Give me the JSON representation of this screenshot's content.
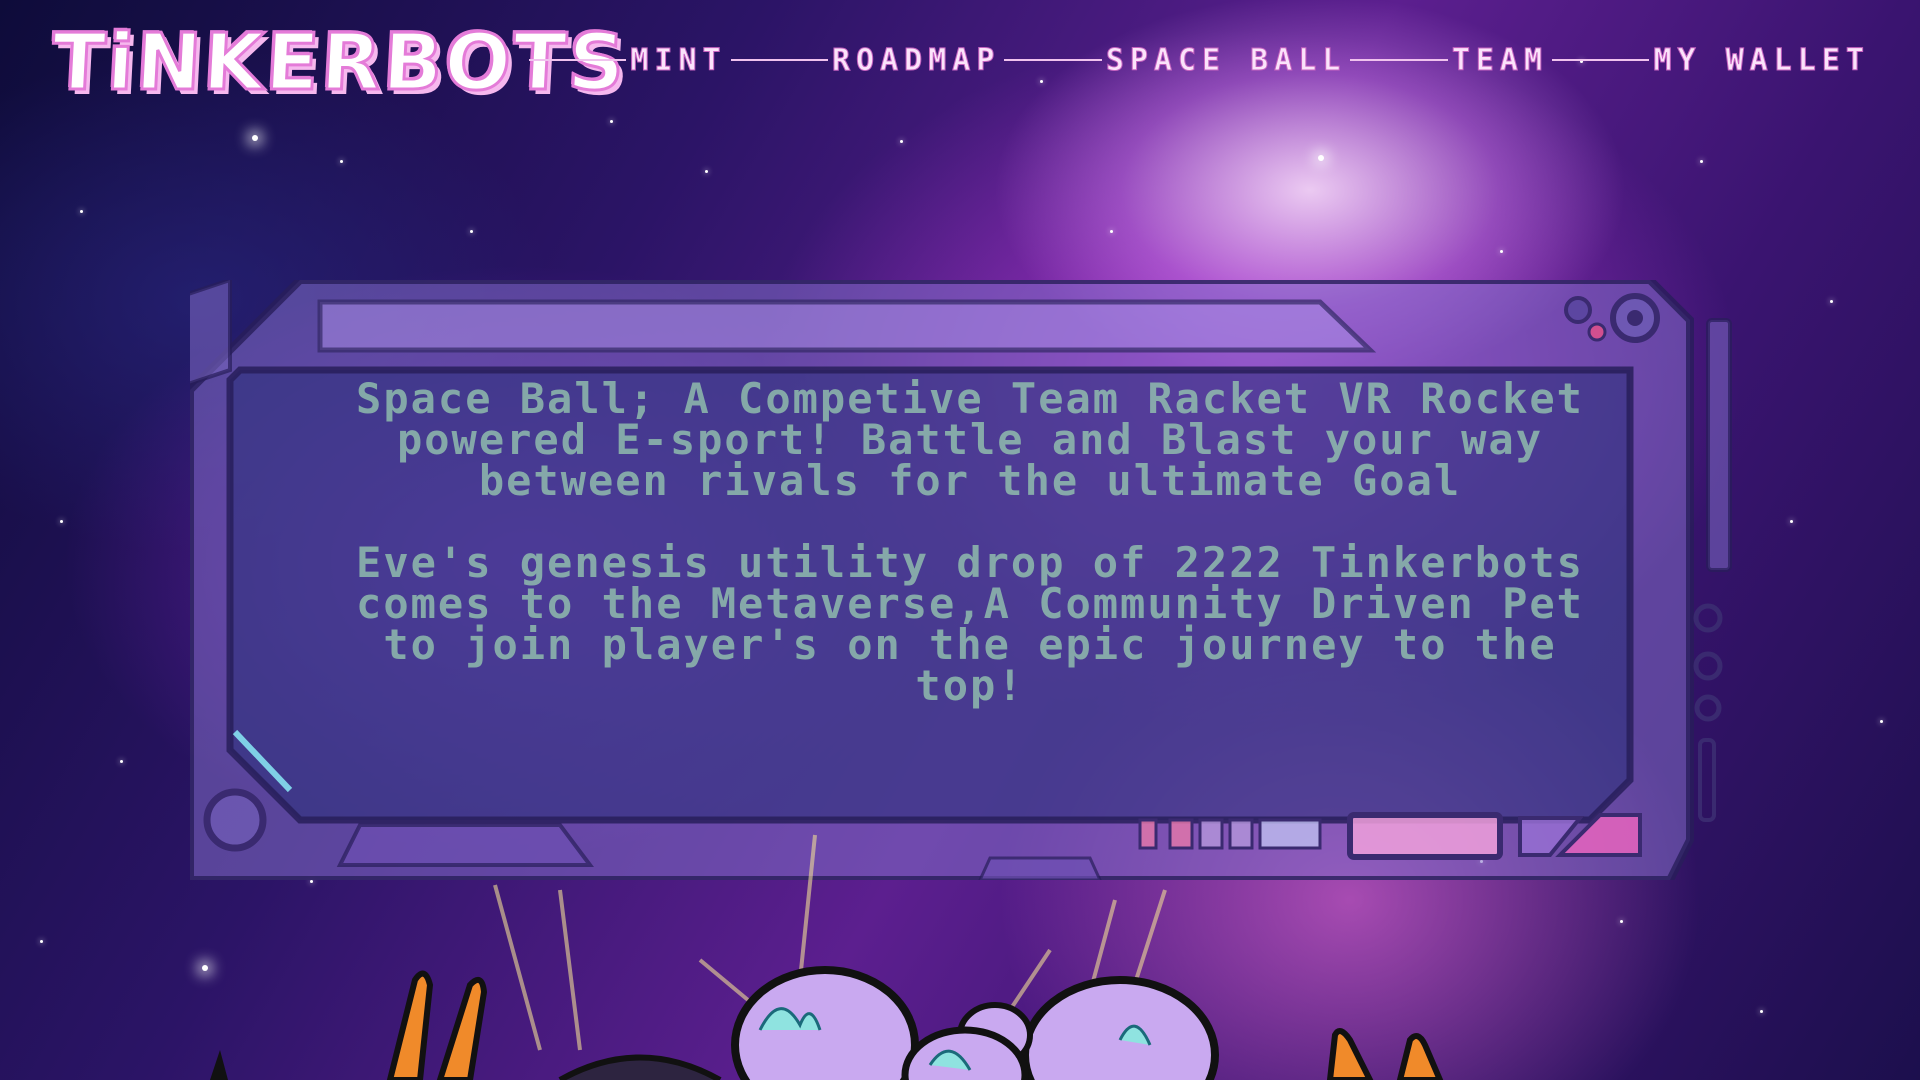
{
  "header": {
    "logo": "TiNKERBOTS",
    "nav": [
      {
        "label": "MINT"
      },
      {
        "label": "ROADMAP"
      },
      {
        "label": "SPACE BALL"
      },
      {
        "label": "TEAM"
      },
      {
        "label": "MY WALLET"
      }
    ]
  },
  "panel": {
    "paragraph1": "Space Ball; A Competive Team Racket VR Rocket powered E-sport! Battle and Blast your way between rivals for the ultimate Goal",
    "paragraph2": "Eve's genesis utility drop of 2222 Tinkerbots comes to the Metaverse,A Community Driven Pet to join player's on the epic journey to the top!"
  },
  "colors": {
    "logo_fill": "#ffffff",
    "logo_outline": "#e47bd8",
    "nav_text": "#fbe3fb",
    "panel_text": "#96c8af",
    "panel_frame": "#8a78c8"
  }
}
